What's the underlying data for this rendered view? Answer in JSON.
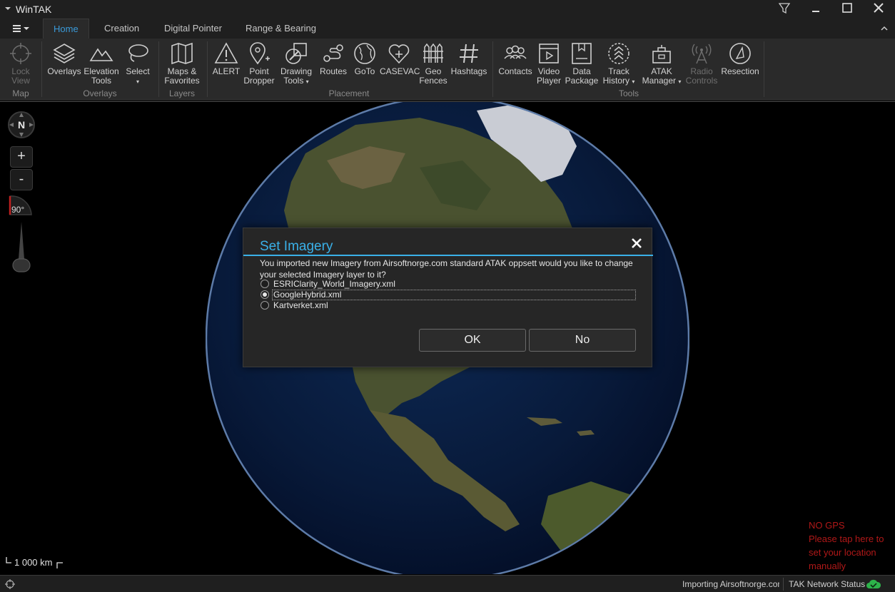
{
  "window": {
    "title": "WinTAK"
  },
  "tabs": [
    {
      "label": "Home",
      "active": true
    },
    {
      "label": "Creation",
      "active": false
    },
    {
      "label": "Digital Pointer",
      "active": false
    },
    {
      "label": "Range & Bearing",
      "active": false
    }
  ],
  "ribbon": {
    "buttons": {
      "lock_view": "Lock\nView",
      "overlays": "Overlays",
      "elevation_tools": "Elevation\nTools",
      "select": "Select",
      "maps_favorites": "Maps &\nFavorites",
      "alert": "ALERT",
      "point_dropper": "Point\nDropper",
      "drawing_tools": "Drawing\nTools",
      "routes": "Routes",
      "goto": "GoTo",
      "casevac": "CASEVAC",
      "geo_fences": "Geo\nFences",
      "hashtags": "Hashtags",
      "contacts": "Contacts",
      "video_player": "Video\nPlayer",
      "data_package": "Data\nPackage",
      "track_history": "Track\nHistory",
      "atak_manager": "ATAK\nManager",
      "radio_controls": "Radio\nControls",
      "resection": "Resection"
    },
    "groups": {
      "map": "Map",
      "overlays": "Overlays",
      "layers": "Layers",
      "placement": "Placement",
      "tools": "Tools"
    }
  },
  "map_controls": {
    "compass_label": "N",
    "zoom_in": "+",
    "zoom_out": "-",
    "tilt": "90°",
    "scale": "1 000 km"
  },
  "gps_warning": {
    "line1": "NO GPS",
    "line2": "Please tap here to set your location manually"
  },
  "statusbar": {
    "importing": "Importing Airsoftnorge.com",
    "network": "TAK Network Status"
  },
  "dialog": {
    "title": "Set Imagery",
    "message": "You imported new Imagery from Airsoftnorge.com standard ATAK oppsett would you like to change your selected Imagery layer to it?",
    "options": [
      {
        "label": "ESRIClarity_World_Imagery.xml",
        "selected": false
      },
      {
        "label": "GoogleHybrid.xml",
        "selected": true
      },
      {
        "label": "Kartverket.xml",
        "selected": false
      }
    ],
    "ok_label": "OK",
    "no_label": "No"
  },
  "colors": {
    "accent": "#3ab0e8",
    "tab_active": "#3a9ad9",
    "warning": "#b01818",
    "status_ok": "#2db24a"
  }
}
